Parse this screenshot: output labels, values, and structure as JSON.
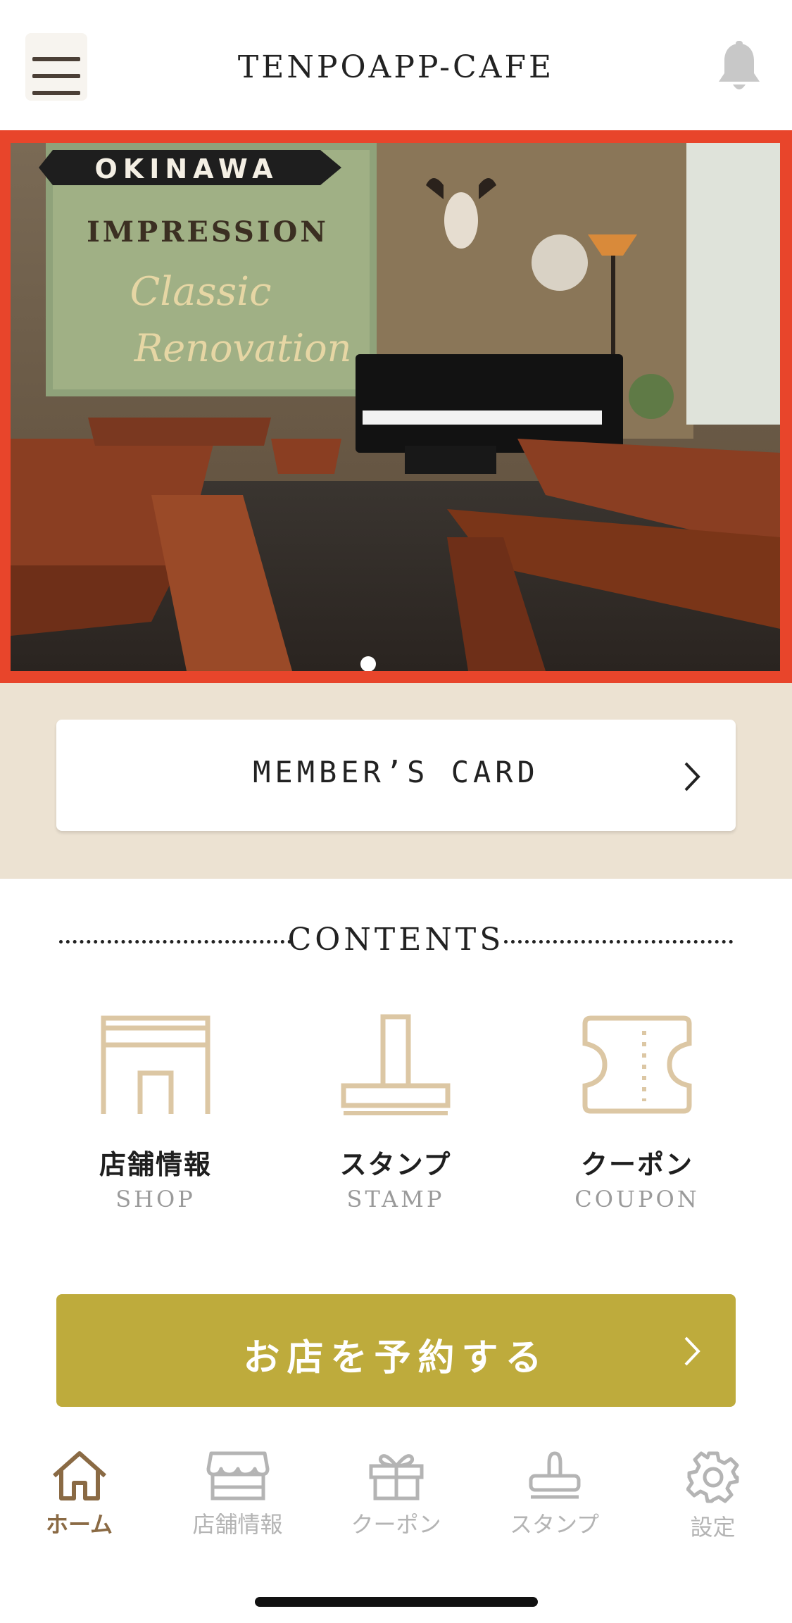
{
  "header": {
    "title": "TENPOAPP-CAFE",
    "menu_icon": "hamburger-menu-icon",
    "notification_icon": "bell-icon"
  },
  "hero": {
    "slide_count": 1,
    "active_slide": 1,
    "image_description_icon": "cafe-interior-photo"
  },
  "member_card": {
    "label": "MEMBER’S CARD",
    "icon": "chevron-right-icon"
  },
  "contents": {
    "title": "CONTENTS",
    "items": [
      {
        "jp": "店舗情報",
        "en": "SHOP",
        "icon": "shop-icon"
      },
      {
        "jp": "スタンプ",
        "en": "STAMP",
        "icon": "stamp-icon"
      },
      {
        "jp": "クーポン",
        "en": "COUPON",
        "icon": "coupon-icon"
      }
    ]
  },
  "reserve": {
    "label": "お店を予約する",
    "icon": "chevron-right-icon"
  },
  "tabbar": {
    "items": [
      {
        "label": "ホーム",
        "icon": "home-icon",
        "active": true
      },
      {
        "label": "店舗情報",
        "icon": "store-icon",
        "active": false
      },
      {
        "label": "クーポン",
        "icon": "gift-icon",
        "active": false
      },
      {
        "label": "スタンプ",
        "icon": "stamp-icon",
        "active": false
      },
      {
        "label": "設定",
        "icon": "gear-icon",
        "active": false
      }
    ]
  },
  "colors": {
    "hero_border": "#e8452b",
    "member_band": "#ece2d2",
    "reserve_button": "#beab3c",
    "icon_beige": "#dcc7a4",
    "active_tab": "#8a6a44"
  }
}
